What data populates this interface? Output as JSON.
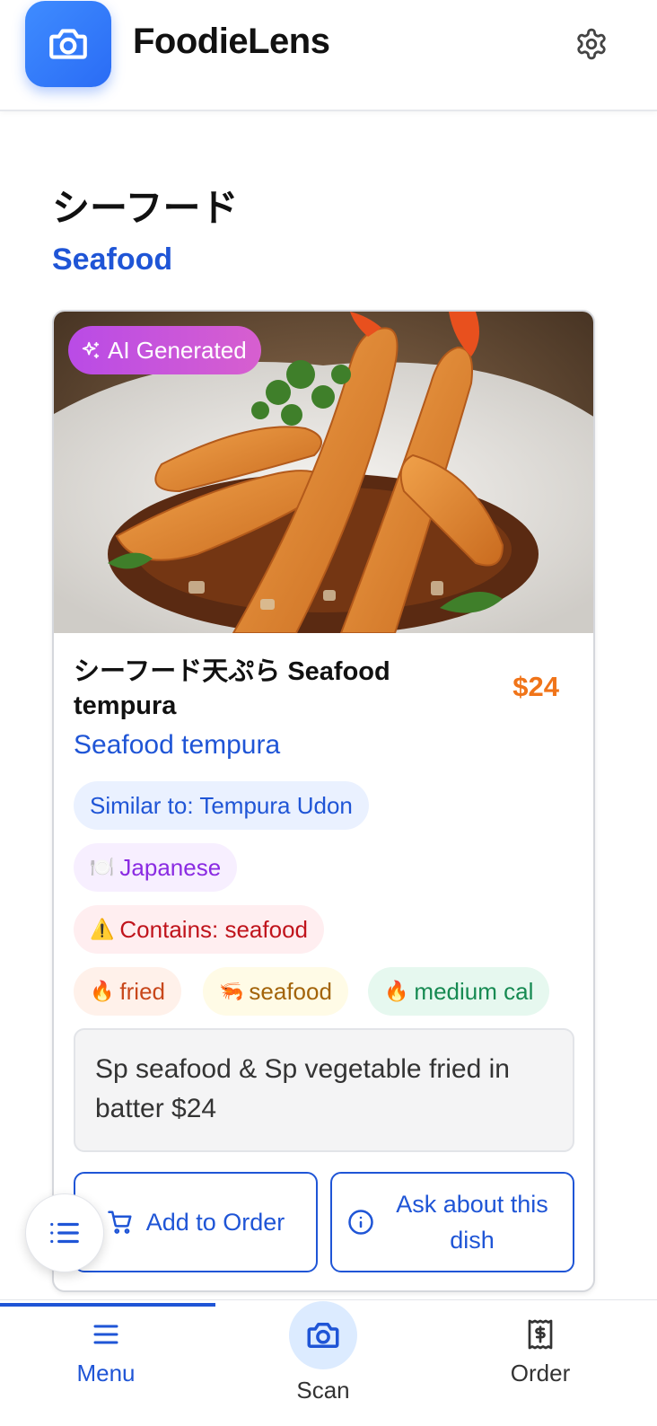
{
  "header": {
    "app_title": "FoodieLens",
    "logo_icon": "camera-icon",
    "settings_icon": "gear-icon"
  },
  "section": {
    "title_jp": "シーフード",
    "title_en": "Seafood"
  },
  "card": {
    "badge": "AI Generated",
    "badge_icon": "sparkles-icon",
    "title": "シーフード天ぷら Seafood tempura",
    "price": "$24",
    "subtitle": "Seafood tempura",
    "similar": "Similar to: Tempura Udon",
    "cuisine": "Japanese",
    "cuisine_icon": "🍽️",
    "allergy": "Contains: seafood",
    "allergy_icon": "⚠️",
    "tags": [
      {
        "icon": "🔥",
        "label": "fried"
      },
      {
        "icon": "🦐",
        "label": "seafood"
      },
      {
        "icon": "🔥",
        "label": "medium cal"
      }
    ],
    "description": "Sp seafood & Sp vegetable fried in batter $24",
    "add_button": "Add to Order",
    "ask_button": "Ask about this dish"
  },
  "bottom_nav": {
    "active": "Menu",
    "items": [
      {
        "label": "Menu",
        "icon": "menu-icon"
      },
      {
        "label": "Scan",
        "icon": "camera-icon"
      },
      {
        "label": "Order",
        "icon": "receipt-icon"
      }
    ]
  },
  "colors": {
    "accent": "#1f55d6",
    "price": "#f07419",
    "badge": "#c457e0"
  }
}
